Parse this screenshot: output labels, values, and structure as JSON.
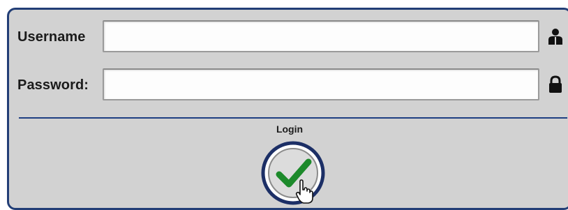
{
  "form": {
    "username": {
      "label": "Username",
      "value": "",
      "icon": "user-icon"
    },
    "password": {
      "label": "Password:",
      "value": "",
      "icon": "lock-icon"
    },
    "login": {
      "label": "Login",
      "icon": "checkmark-icon"
    }
  },
  "colors": {
    "panel_bg": "#d2d2d2",
    "border": "#223e76",
    "check": "#1d8a2b"
  }
}
